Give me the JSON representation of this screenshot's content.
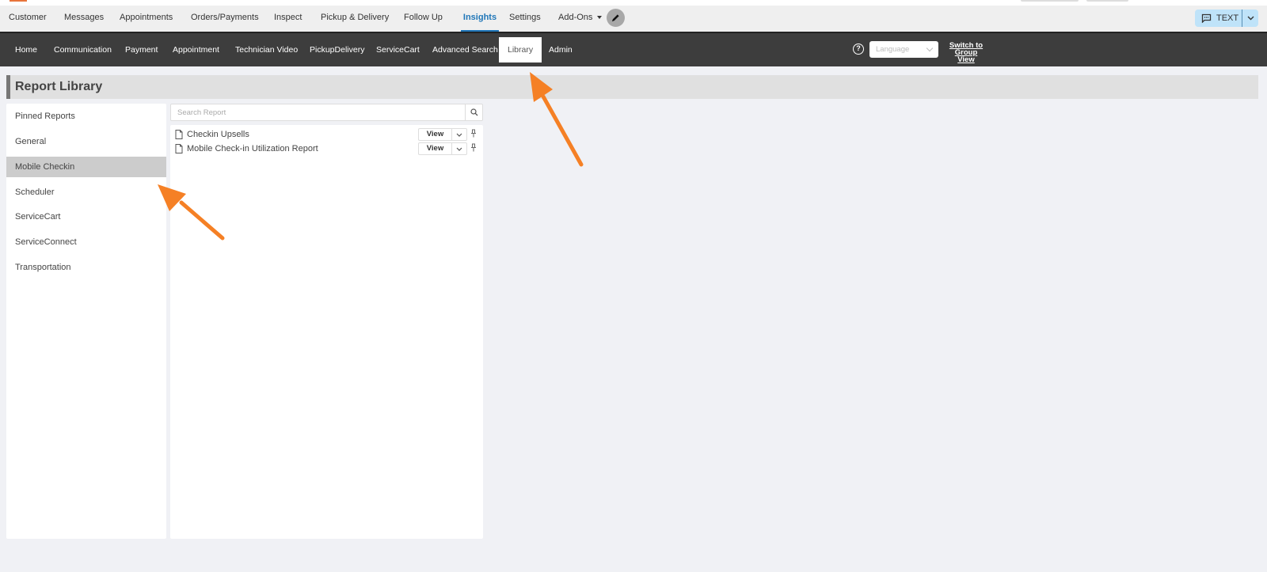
{
  "colors": {
    "accent_blue": "#1f76b8",
    "subnav_bg": "#3d3d3d",
    "annotation_arrow": "#f58025",
    "text_button_bg": "#bfe3f9"
  },
  "main_nav": {
    "items": [
      {
        "label": "Customer",
        "active": false
      },
      {
        "label": "Messages",
        "active": false
      },
      {
        "label": "Appointments",
        "active": false
      },
      {
        "label": "Orders/Payments",
        "active": false
      },
      {
        "label": "Inspect",
        "active": false
      },
      {
        "label": "Pickup & Delivery",
        "active": false
      },
      {
        "label": "Follow Up",
        "active": false
      },
      {
        "label": "Insights",
        "active": true
      },
      {
        "label": "Settings",
        "active": false
      },
      {
        "label": "Add-Ons",
        "active": false
      }
    ],
    "edit_icon": "pencil-icon",
    "text_button": {
      "label": "TEXT",
      "icon": "chat-icon"
    }
  },
  "sub_nav": {
    "items": [
      {
        "label": "Home",
        "active": false
      },
      {
        "label": "Communication",
        "active": false
      },
      {
        "label": "Payment",
        "active": false
      },
      {
        "label": "Appointment",
        "active": false
      },
      {
        "label": "Technician Video",
        "active": false
      },
      {
        "label": "PickupDelivery",
        "active": false
      },
      {
        "label": "ServiceCart",
        "active": false
      },
      {
        "label": "Advanced Search",
        "active": false
      },
      {
        "label": "Library",
        "active": true
      },
      {
        "label": "Admin",
        "active": false
      }
    ],
    "help_icon": "?",
    "language_placeholder": "Language",
    "switch_view": {
      "line1": "Switch to",
      "line2": "Group View"
    }
  },
  "page": {
    "title": "Report Library"
  },
  "sidebar": {
    "categories": [
      {
        "label": "Pinned Reports",
        "selected": false
      },
      {
        "label": "General",
        "selected": false
      },
      {
        "label": "Mobile Checkin",
        "selected": true
      },
      {
        "label": "Scheduler",
        "selected": false
      },
      {
        "label": "ServiceCart",
        "selected": false
      },
      {
        "label": "ServiceConnect",
        "selected": false
      },
      {
        "label": "Transportation",
        "selected": false
      }
    ]
  },
  "search": {
    "placeholder": "Search Report",
    "value": ""
  },
  "reports": [
    {
      "name": "Checkin Upsells",
      "view_label": "View"
    },
    {
      "name": "Mobile Check-in Utilization Report",
      "view_label": "View"
    }
  ]
}
